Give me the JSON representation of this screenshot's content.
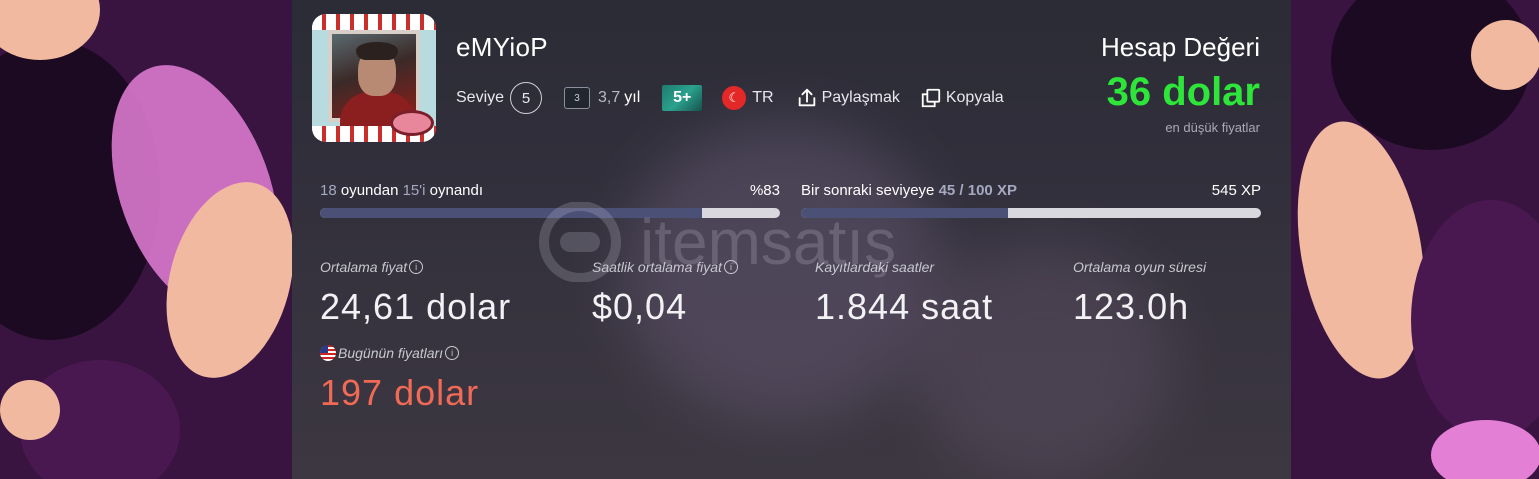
{
  "profile": {
    "username": "eMYioP",
    "level_label": "Seviye",
    "level": "5",
    "years_badge": "3",
    "years_value": "3,7",
    "years_unit": "yıl",
    "plus_badge": "5+",
    "flag_symbol": "☾",
    "country": "TR",
    "share_label": "Paylaşmak",
    "copy_label": "Kopyala"
  },
  "account_value": {
    "title": "Hesap Değeri",
    "amount": "36 dolar",
    "subtitle": "en düşük fiyatlar",
    "color": "#2ee63a"
  },
  "progress": {
    "games": {
      "total": "18",
      "text1": " oyundan ",
      "played": "15'i",
      "text2": " oynandı",
      "percent_label": "%83",
      "percent": 0.83
    },
    "xp": {
      "text": "Bir sonraki seviyeye ",
      "current": "45 / 100 XP",
      "total_label": "545 XP",
      "fraction": 0.45
    }
  },
  "stats": [
    {
      "label": "Ortalama fiyat",
      "value": "24,61 dolar",
      "info": true
    },
    {
      "label": "Saatlik ortalama fiyat",
      "value": "$0,04",
      "info": true
    },
    {
      "label": "Kayıtlardaki saatler",
      "value": "1.844 saat",
      "info": false
    },
    {
      "label": "Ortalama oyun süresi",
      "value": "123.0h",
      "info": false
    }
  ],
  "today": {
    "label": "Bugünün fiyatları",
    "value": "197 dolar",
    "color": "#f06a55"
  },
  "watermark": "itemsatış"
}
